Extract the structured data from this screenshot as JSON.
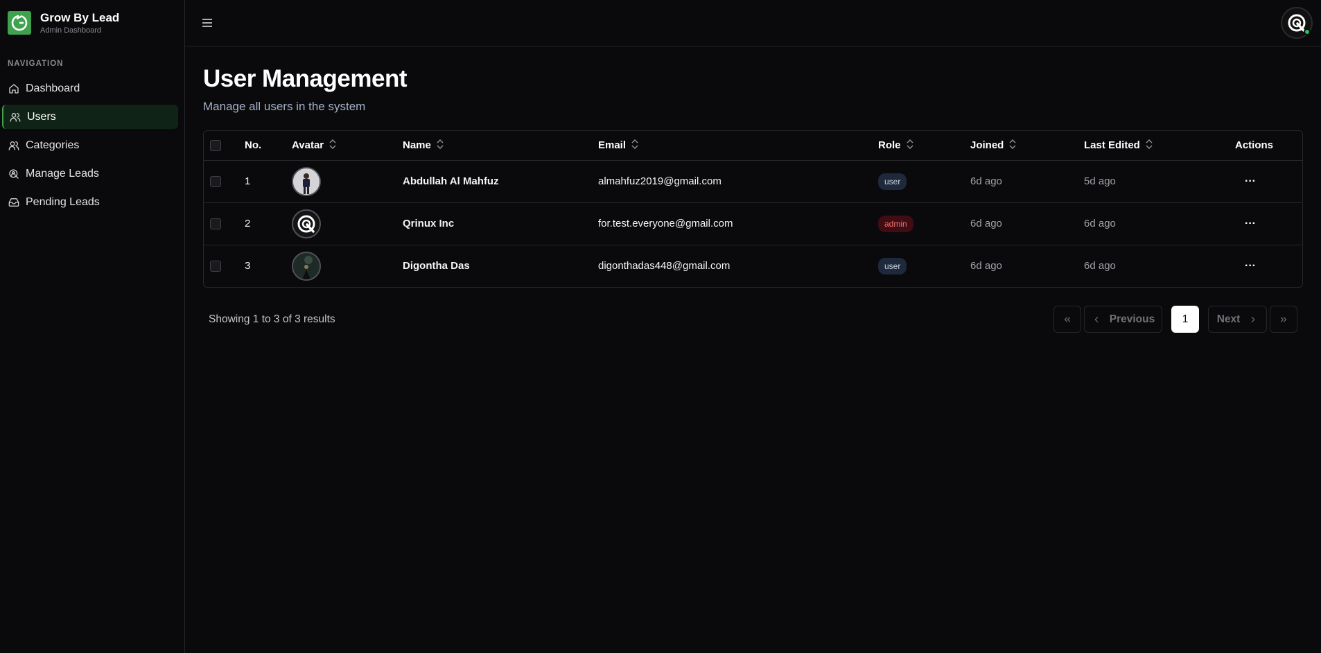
{
  "brand": {
    "title": "Grow By Lead",
    "subtitle": "Admin Dashboard"
  },
  "nav": {
    "heading": "NAVIGATION",
    "items": [
      {
        "label": "Dashboard",
        "icon": "home-icon",
        "active": false
      },
      {
        "label": "Users",
        "icon": "users-icon",
        "active": true
      },
      {
        "label": "Categories",
        "icon": "users-icon",
        "active": false
      },
      {
        "label": "Manage Leads",
        "icon": "search-user-icon",
        "active": false
      },
      {
        "label": "Pending Leads",
        "icon": "inbox-icon",
        "active": false
      }
    ]
  },
  "header": {
    "menu_icon": "hamburger-icon",
    "avatar_icon": "qrinux-logo-icon",
    "status_color": "#22c55e"
  },
  "page": {
    "title": "User Management",
    "subtitle": "Manage all users in the system"
  },
  "table": {
    "columns": [
      "No.",
      "Avatar",
      "Name",
      "Email",
      "Role",
      "Joined",
      "Last Edited",
      "Actions"
    ],
    "rows": [
      {
        "no": "1",
        "name": "Abdullah Al Mahfuz",
        "email": "almahfuz2019@gmail.com",
        "role": "user",
        "joined": "6d ago",
        "edited": "5d ago"
      },
      {
        "no": "2",
        "name": "Qrinux Inc",
        "email": "for.test.everyone@gmail.com",
        "role": "admin",
        "joined": "6d ago",
        "edited": "6d ago"
      },
      {
        "no": "3",
        "name": "Digontha Das",
        "email": "digonthadas448@gmail.com",
        "role": "user",
        "joined": "6d ago",
        "edited": "6d ago"
      }
    ],
    "actions_icon": "more-horizontal-icon"
  },
  "pagination": {
    "summary": "Showing 1 to 3 of 3 results",
    "previous": "Previous",
    "next": "Next",
    "current_page": "1"
  },
  "colors": {
    "accent": "#3fa34d",
    "admin_badge": "#f87171",
    "user_badge": "#cbd5e1"
  }
}
